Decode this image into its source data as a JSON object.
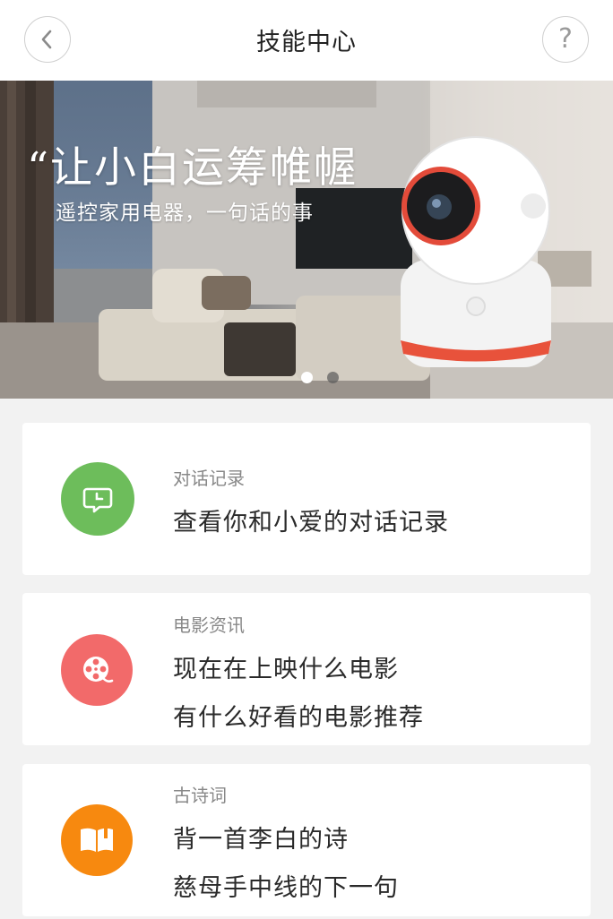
{
  "header": {
    "title": "技能中心",
    "back_icon": "chevron-left-icon",
    "help_label": "?"
  },
  "banner": {
    "headline": "“让小白运筹帷幄",
    "subline": "遥控家用电器，一句话的事",
    "slide_count": 2,
    "active_slide": 1
  },
  "skills": [
    {
      "icon": "chat-clock-icon",
      "color": "#6dbd5b",
      "category": "对话记录",
      "examples": [
        "查看你和小爱的对话记录"
      ]
    },
    {
      "icon": "film-reel-icon",
      "color": "#f26a6a",
      "category": "电影资讯",
      "examples": [
        "现在在上映什么电影",
        "有什么好看的电影推荐"
      ]
    },
    {
      "icon": "book-icon",
      "color": "#f7890f",
      "category": "古诗词",
      "examples": [
        "背一首李白的诗",
        "慈母手中线的下一句"
      ]
    }
  ]
}
